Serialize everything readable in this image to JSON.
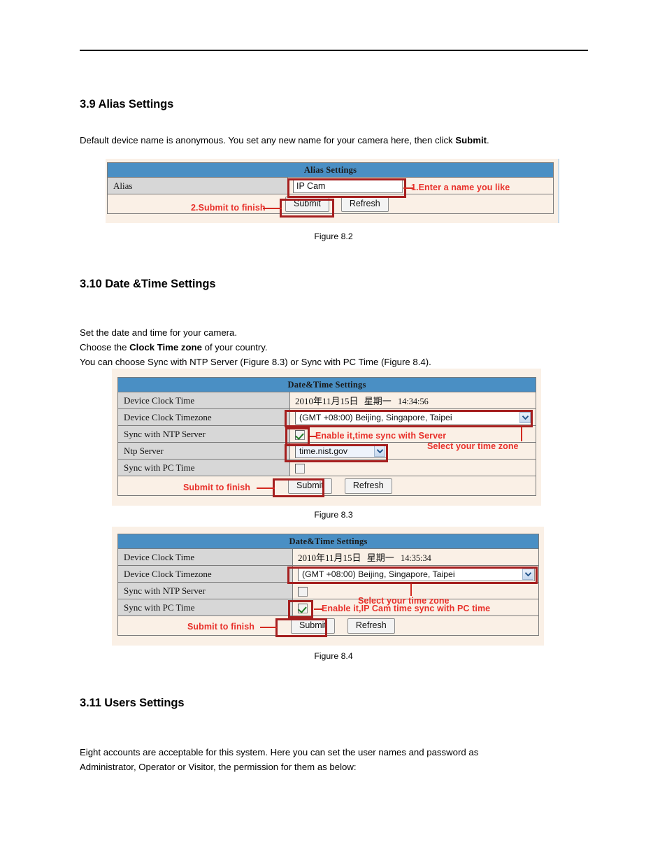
{
  "document": {
    "sections": [
      {
        "id": "alias",
        "heading": "3.9 Alias Settings",
        "body_prefix": "Default device name is anonymous. You set any new name for your camera here, then click ",
        "body_bold": "Submit",
        "body_suffix": ".",
        "figure_caption": "Figure 8.2"
      },
      {
        "id": "datetime",
        "heading": "3.10 Date &Time Settings",
        "line1": "Set the date and time for your camera.",
        "line2_prefix": "Choose the ",
        "line2_bold": "Clock Time zone",
        "line2_suffix": " of your country.",
        "line3": "You can choose Sync with NTP Server (Figure 8.3) or Sync with PC Time (Figure 8.4).",
        "figure_caption_83": "Figure 8.3",
        "figure_caption_84": "Figure 8.4"
      },
      {
        "id": "users",
        "heading": "3.11 Users Settings",
        "line1": "Eight accounts are acceptable for this system. Here you can set the user names and password as",
        "line2": "Administrator, Operator or Visitor, the permission for them as below:"
      }
    ]
  },
  "alias_panel": {
    "title": "Alias Settings",
    "row_label": "Alias",
    "input_value": "IP Cam",
    "input_placeholder": "",
    "submit_label": "Submit",
    "refresh_label": "Refresh",
    "annotations": {
      "enter_name": "1.Enter a name you like",
      "submit_finish": "2.Submit to finish"
    }
  },
  "datetime_panel_83": {
    "title": "Date&Time Settings",
    "rows": [
      {
        "label": "Device Clock Time",
        "value": "2010年11月15日  14:34:56",
        "value_cjk_date": "2010年11月15日",
        "value_weekday": "星期一",
        "value_time": "14:34:56"
      },
      {
        "label": "Device Clock Timezone",
        "value": "(GMT +08:00) Beijing, Singapore, Taipei"
      },
      {
        "label": "Sync with NTP Server",
        "checked": true
      },
      {
        "label": "Ntp Server",
        "value": "time.nist.gov"
      },
      {
        "label": "Sync with PC Time",
        "checked": false
      }
    ],
    "submit_label": "Submit",
    "refresh_label": "Refresh",
    "annotations": {
      "enable_ntp": "Enable it,time sync with Server",
      "select_timezone": "Select your time zone",
      "submit_finish": "Submit to finish"
    }
  },
  "datetime_panel_84": {
    "title": "Date&Time Settings",
    "rows": [
      {
        "label": "Device Clock Time",
        "value": "2010年11月15日  14:35:34",
        "value_cjk_date": "2010年11月15日",
        "value_weekday": "星期一",
        "value_time": "14:35:34"
      },
      {
        "label": "Device Clock Timezone",
        "value": "(GMT +08:00) Beijing, Singapore, Taipei"
      },
      {
        "label": "Sync with NTP Server",
        "checked": false
      },
      {
        "label": "Sync with PC Time",
        "checked": true
      }
    ],
    "submit_label": "Submit",
    "refresh_label": "Refresh",
    "annotations": {
      "select_timezone": "Select your time zone",
      "enable_pc": "Enable it,IP Cam time sync with PC time",
      "submit_finish": "Submit to finish"
    }
  },
  "colors": {
    "table_header_blue": "#4a8fc4",
    "label_gray": "#d7d7d7",
    "panel_beige": "#faf0e6",
    "annotation_red": "#e8302a",
    "highlight_box_red": "#a51f1f",
    "check_green": "#1e7b23"
  }
}
